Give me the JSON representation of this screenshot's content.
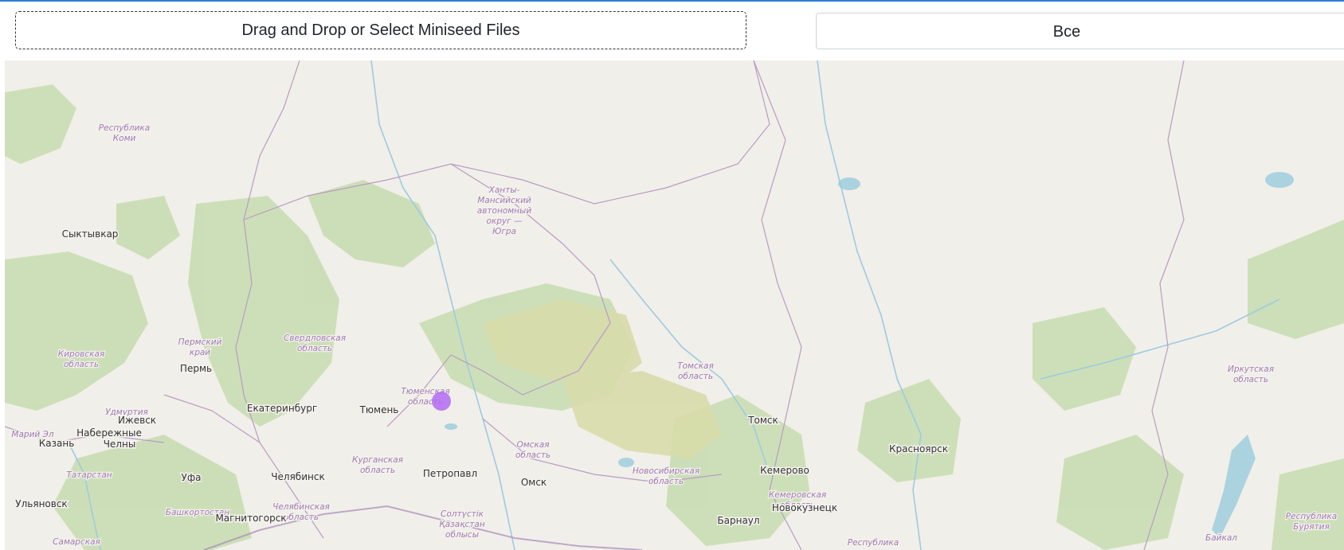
{
  "upload": {
    "label": "Drag and Drop or Select Miniseed Files"
  },
  "filter": {
    "selected": "Все"
  },
  "map": {
    "cities": {
      "syktyvkar": "Сыктывкар",
      "perm": "Пермь",
      "yekaterinburg": "Екатеринбург",
      "tyumen": "Тюмень",
      "izhevsk": "Ижевск",
      "naberezhnye_1": "Набережные",
      "naberezhnye_2": "Челны",
      "kazan": "Казань",
      "ufa": "Уфа",
      "chelyabinsk": "Челябинск",
      "petropavl": "Петропавл",
      "omsk": "Омск",
      "tomsk": "Томск",
      "krasnoyarsk": "Красноярск",
      "kemerovo": "Кемерово",
      "novokuznetsk": "Новокузнецк",
      "barnaul": "Барнаул",
      "ulyanovsk": "Ульяновск",
      "magnitogorsk": "Магнитогорск"
    },
    "regions": {
      "komi_1": "Республика",
      "komi_2": "Коми",
      "khmao_1": "Ханты-",
      "khmao_2": "Мансийский",
      "khmao_3": "автономный",
      "khmao_4": "округ —",
      "khmao_5": "Югра",
      "perm_krai_1": "Пермский",
      "perm_krai_2": "край",
      "sverdlovsk_1": "Свердловская",
      "sverdlovsk_2": "область",
      "kirov_1": "Кировская",
      "kirov_2": "область",
      "tyumen_1": "Тюменская",
      "tyumen_2": "область",
      "udmurtia": "Удмуртия",
      "mari_el": "Марий Эл",
      "tatarstan": "Татарстан",
      "kurgan_1": "Курганская",
      "kurgan_2": "область",
      "omsk_1": "Омская",
      "omsk_2": "область",
      "tomsk_1": "Томская",
      "tomsk_2": "область",
      "novosibirsk_1": "Новосибирская",
      "novosibirsk_2": "область",
      "kemerovo_1": "Кемеровская",
      "kemerovo_2": "область",
      "bashkortostan": "Башкортостан",
      "chelyabinsk_1": "Челябинская",
      "chelyabinsk_2": "область",
      "kazakhstan_1": "Солтүстік",
      "kazakhstan_2": "Қазақстан",
      "kazakhstan_3": "облысы",
      "samara": "Самарская",
      "irkutsk_1": "Иркутская",
      "irkutsk_2": "область",
      "buryatia_1": "Республика",
      "buryatia_2": "Бурятия",
      "altai": "Республика",
      "baikal": "Байкал"
    },
    "marker_color": "#b36bf2"
  }
}
